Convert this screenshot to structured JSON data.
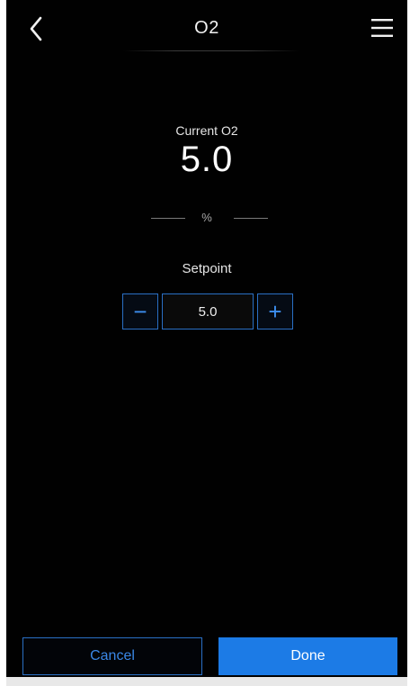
{
  "header": {
    "title": "O2",
    "back_icon": "chevron-left-icon",
    "menu_icon": "hamburger-menu-icon"
  },
  "reading": {
    "label": "Current O2",
    "value": "5.0",
    "unit": "%"
  },
  "setpoint": {
    "label": "Setpoint",
    "value": "5.0",
    "decrement_label": "−",
    "increment_label": "+"
  },
  "footer": {
    "cancel_label": "Cancel",
    "done_label": "Done"
  },
  "colors": {
    "background": "#010101",
    "accent": "#1c7be6",
    "accent_border": "#2a6fc4",
    "text": "#ffffff"
  }
}
